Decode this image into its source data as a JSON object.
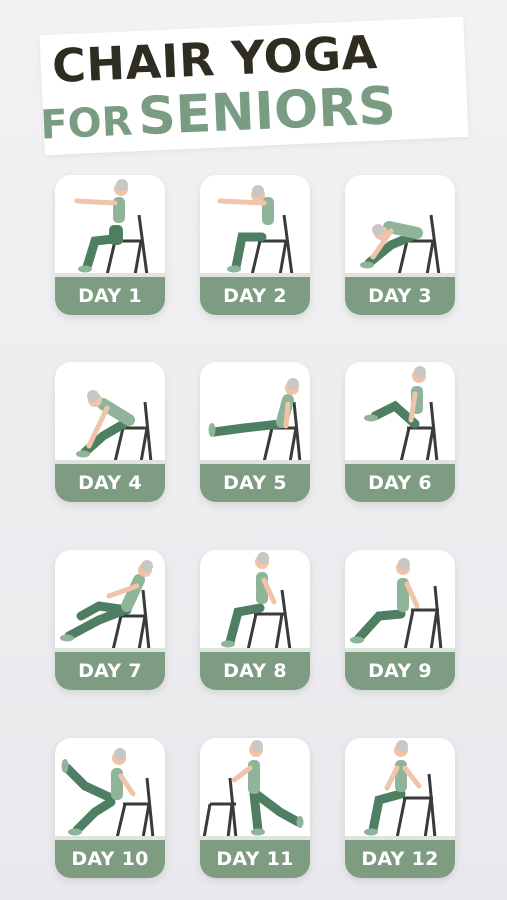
{
  "title": {
    "line1": "CHAIR YOGA",
    "line2_a": "FOR",
    "line2_b": "SENIORS"
  },
  "days": [
    {
      "label": "DAY 1",
      "pose": "seated-arms-forward"
    },
    {
      "label": "DAY 2",
      "pose": "seated-arms-forward-lean"
    },
    {
      "label": "DAY 3",
      "pose": "seated-forward-fold"
    },
    {
      "label": "DAY 4",
      "pose": "forward-bend-reach-toes"
    },
    {
      "label": "DAY 5",
      "pose": "seated-leg-extension-plank"
    },
    {
      "label": "DAY 6",
      "pose": "seated-knee-lift"
    },
    {
      "label": "DAY 7",
      "pose": "seated-twist-knee"
    },
    {
      "label": "DAY 8",
      "pose": "seated-hands-on-chair"
    },
    {
      "label": "DAY 9",
      "pose": "chair-dip"
    },
    {
      "label": "DAY 10",
      "pose": "seated-leg-raise"
    },
    {
      "label": "DAY 11",
      "pose": "standing-leg-back"
    },
    {
      "label": "DAY 12",
      "pose": "seated-arms-behind"
    }
  ],
  "colors": {
    "dark": "#2f2d22",
    "sage": "#7d9c82",
    "leggings": "#4f7f62",
    "top": "#8fb49a",
    "skin": "#f0c4a8",
    "hair": "#c9c6c3",
    "chair": "#3a3a3a"
  }
}
